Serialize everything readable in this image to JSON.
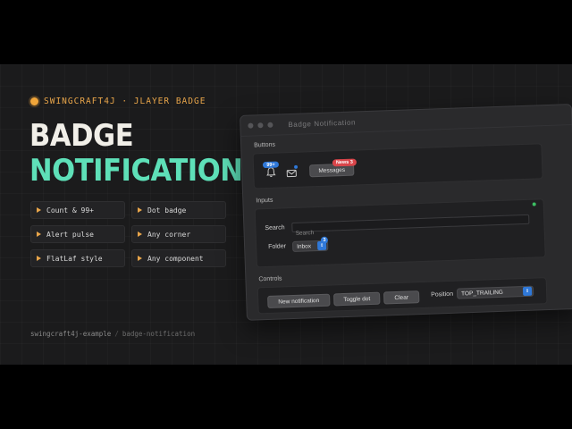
{
  "brand": {
    "label": "SWINGCRAFT4J · JLAYER BADGE"
  },
  "hero": {
    "line1": "BADGE",
    "line2": "NOTIFICATION"
  },
  "features": [
    {
      "label": "Count & 99+"
    },
    {
      "label": "Dot badge"
    },
    {
      "label": "Alert pulse"
    },
    {
      "label": "Any corner"
    },
    {
      "label": "FlatLaf style"
    },
    {
      "label": "Any component"
    }
  ],
  "path": {
    "repo": "swingcraft4j-example",
    "separator": "/",
    "slug": "badge-notification"
  },
  "window": {
    "title": "Badge Notification",
    "buttons_section": {
      "label": "Buttons",
      "bell_badge": "99+",
      "messages_label": "Messages",
      "news_badge": "News 3"
    },
    "inputs_section": {
      "label": "Inputs",
      "search_label": "Search",
      "search_placeholder": "Search",
      "folder_label": "Folder",
      "folder_value": "Inbox",
      "folder_badge": "3"
    },
    "controls_section": {
      "label": "Controls",
      "new_notification": "New notification",
      "toggle_dot": "Toggle dot",
      "clear": "Clear",
      "position_label": "Position",
      "position_value": "TOP_TRAILING"
    }
  },
  "colors": {
    "accent_orange": "#e8a54a",
    "accent_teal": "#5ee0b8",
    "badge_blue": "#2f78d8",
    "badge_red": "#d9454a",
    "status_green": "#3cbf63"
  },
  "icons": [
    "bell-icon",
    "mail-icon",
    "caret-right-icon",
    "chevron-updown-icon"
  ]
}
